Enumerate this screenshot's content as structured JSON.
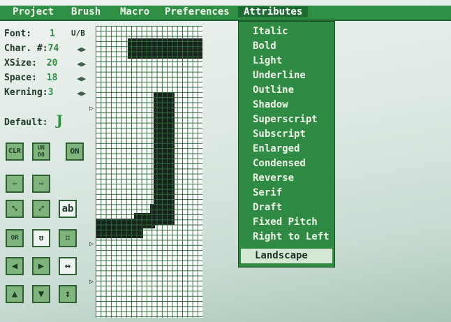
{
  "menubar": {
    "items": [
      "Project",
      "Brush",
      "Macro",
      "Preferences",
      "Attributes"
    ],
    "active": "Attributes"
  },
  "panel": {
    "font_label": "Font:",
    "font_value": "1",
    "font_mode": "U/B",
    "char_label": "Char. #:",
    "char_value": "74",
    "xsize_label": "XSize:",
    "xsize_value": "20",
    "space_label": "Space:",
    "space_value": "18",
    "kerning_label": "Kerning:",
    "kerning_value": "3",
    "default_label": "Default:",
    "default_glyph": "J"
  },
  "tools": {
    "clr": "CLR",
    "undo": "UN DO",
    "on": "ON",
    "ab": "ab",
    "or": "OR",
    "tilde": "ʊ"
  },
  "attributes_menu": {
    "items": [
      "Italic",
      "Bold",
      "Light",
      "Underline",
      "Outline",
      "Shadow",
      "Superscript",
      "Subscript",
      "Enlarged",
      "Condensed",
      "Reverse",
      "Serif",
      "Draft",
      "Fixed Pitch",
      "Right to Left",
      "Landscape"
    ],
    "selected": "Landscape"
  },
  "colors": {
    "accent": "#2e8f45",
    "menu_bg": "#2f8a43",
    "pixel": "#17231a"
  }
}
